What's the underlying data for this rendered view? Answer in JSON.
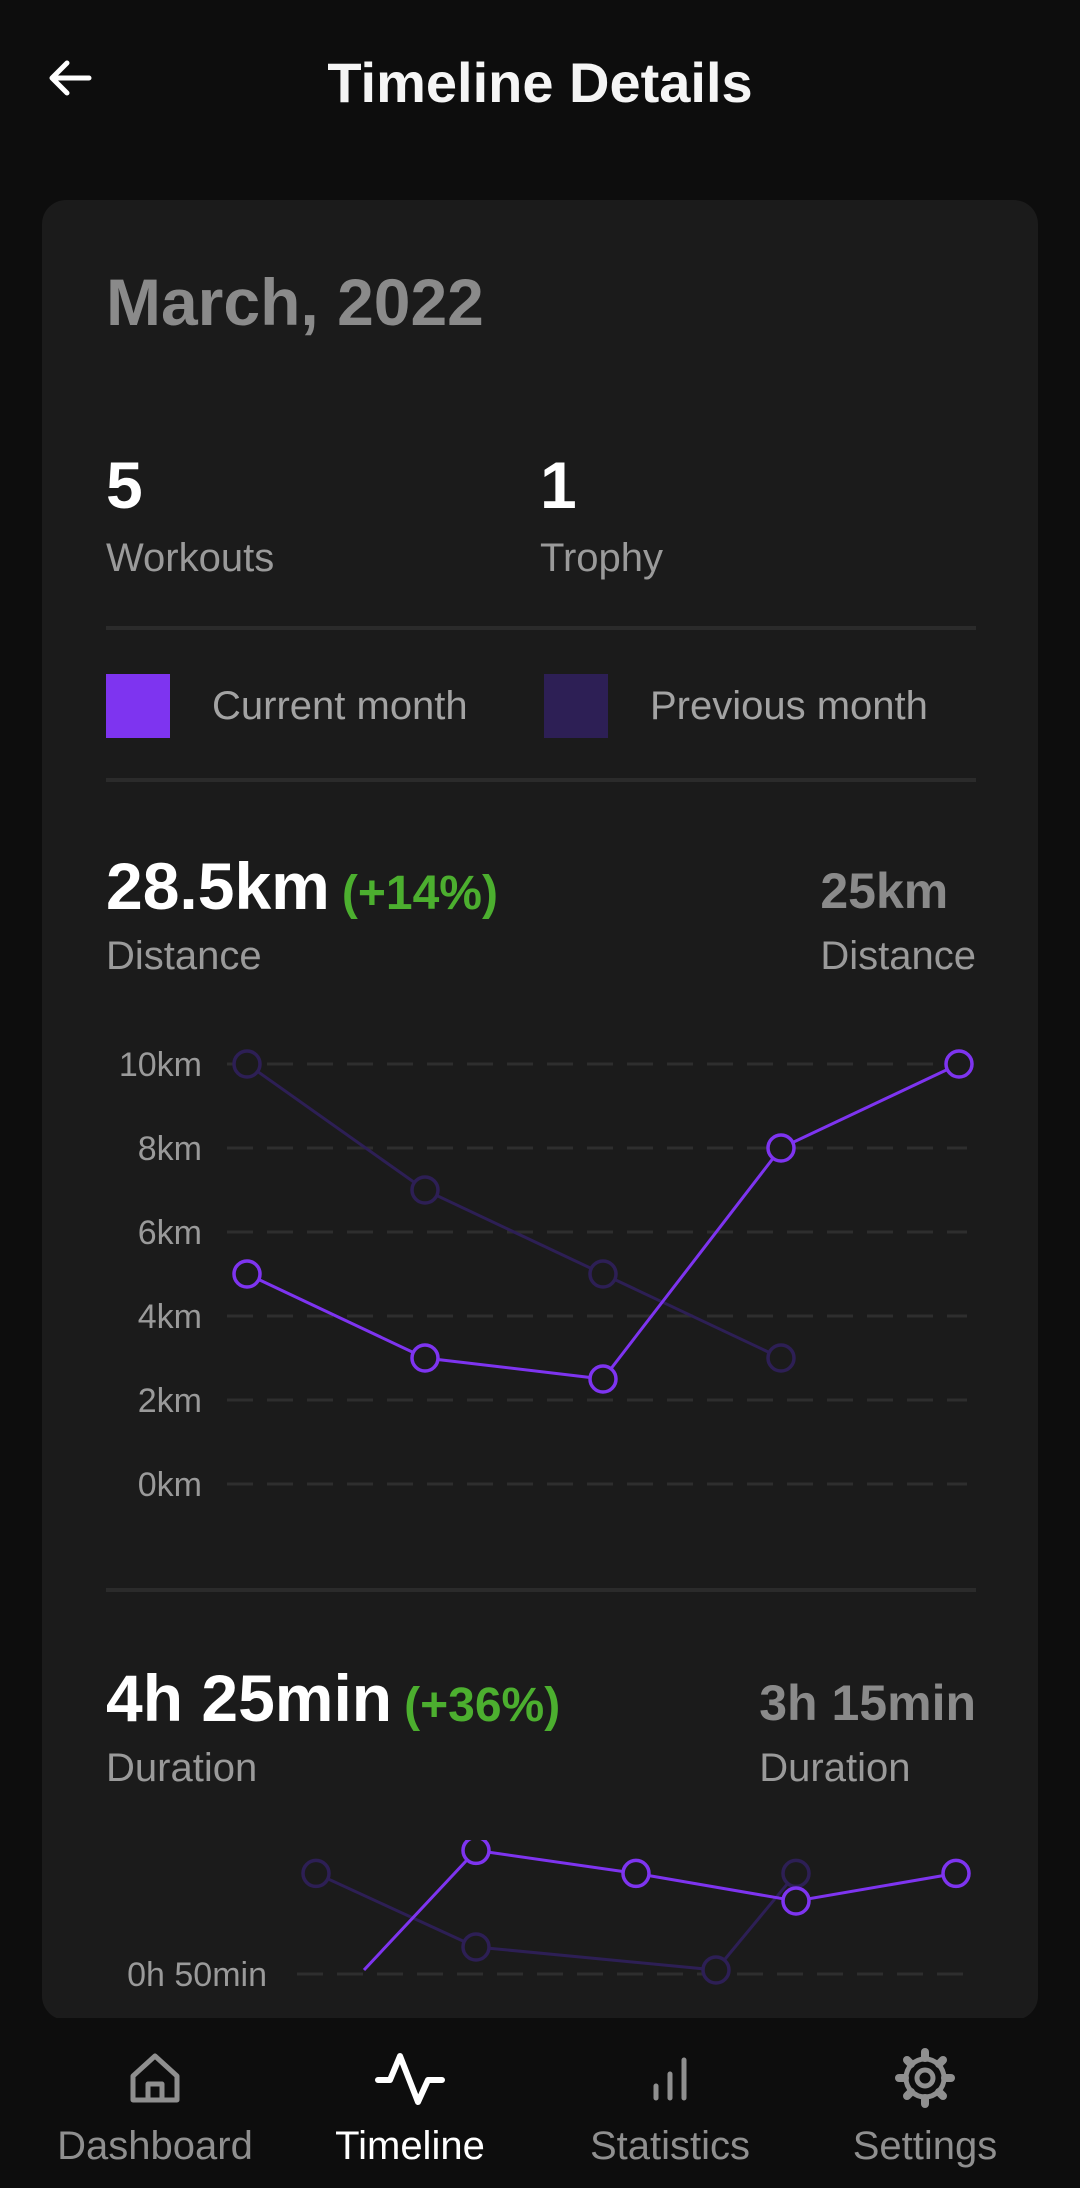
{
  "header": {
    "title": "Timeline Details",
    "back_icon": "arrow-left-icon"
  },
  "card": {
    "month": "March, 2022",
    "stats": [
      {
        "value": "5",
        "label": "Workouts"
      },
      {
        "value": "1",
        "label": "Trophy"
      }
    ],
    "legend": [
      {
        "label": "Current month",
        "color": "#7e34f0"
      },
      {
        "label": "Previous month",
        "color": "#2d1f55"
      }
    ],
    "distance": {
      "value": "28.5km",
      "change": "(+14%)",
      "label": "Distance",
      "prev_value": "25km",
      "prev_label": "Distance"
    },
    "duration": {
      "value": "4h 25min",
      "change": "(+36%)",
      "label": "Duration",
      "prev_value": "3h 15min",
      "prev_label": "Duration"
    }
  },
  "chart_data": [
    {
      "type": "line",
      "ylabels": [
        "10km",
        "8km",
        "6km",
        "4km",
        "2km",
        "0km"
      ],
      "ylim": [
        0,
        10
      ],
      "grid": true,
      "series": [
        {
          "name": "Current month",
          "color": "#7e34f0",
          "x": [
            1,
            2,
            3,
            4,
            5
          ],
          "values": [
            5,
            3,
            2.5,
            8,
            10
          ]
        },
        {
          "name": "Previous month",
          "color": "#2d1f55",
          "x": [
            1,
            2,
            3,
            4
          ],
          "values": [
            10,
            7,
            5,
            3
          ]
        }
      ]
    },
    {
      "type": "line",
      "ylabels": [
        "0h 50min"
      ],
      "grid": true,
      "series": [
        {
          "name": "Current month",
          "color": "#7e34f0",
          "x": [
            0.3,
            1,
            2,
            3,
            4
          ],
          "values": [
            20,
            72,
            62,
            50,
            62
          ]
        },
        {
          "name": "Previous month",
          "color": "#2d1f55",
          "x": [
            0,
            1,
            2.5,
            3
          ],
          "values": [
            62,
            30,
            20,
            62
          ]
        }
      ]
    }
  ],
  "nav": [
    {
      "label": "Dashboard",
      "icon": "home-icon",
      "active": false
    },
    {
      "label": "Timeline",
      "icon": "pulse-icon",
      "active": true
    },
    {
      "label": "Statistics",
      "icon": "bar-chart-icon",
      "active": false
    },
    {
      "label": "Settings",
      "icon": "gear-icon",
      "active": false
    }
  ]
}
